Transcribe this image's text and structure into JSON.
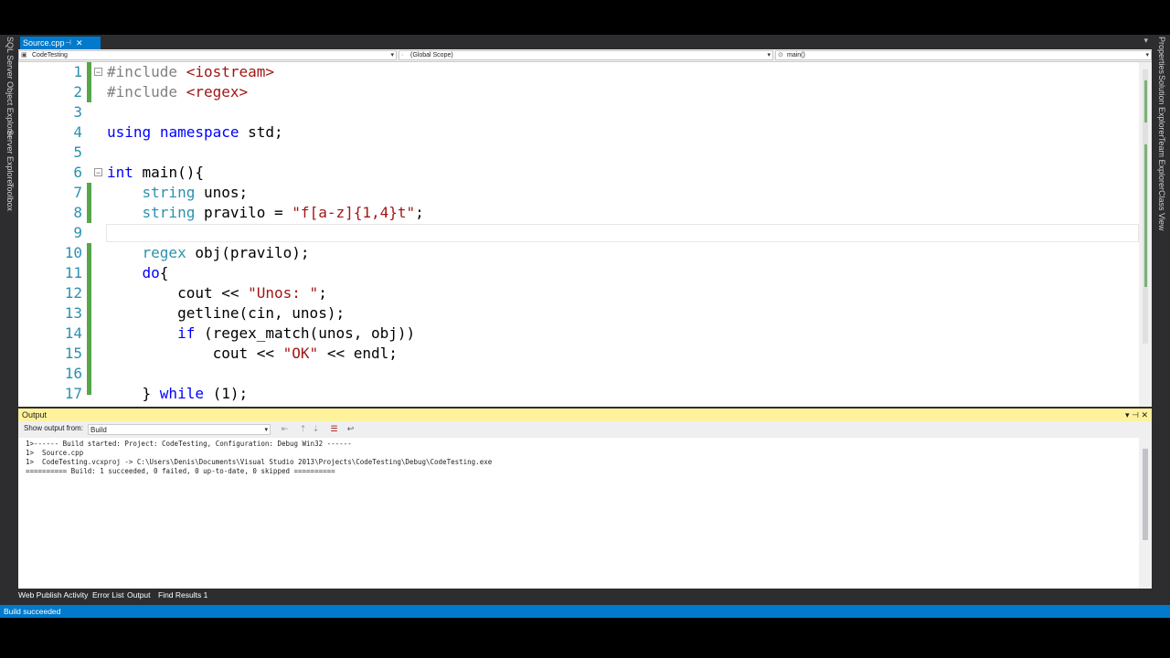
{
  "colors": {
    "accent": "#007acc",
    "line_numbers": "#2b91af",
    "keyword": "#0000ff",
    "preprocessor": "#808080",
    "string": "#a31515",
    "change_marker": "#57a64a",
    "output_title_bg": "#fff29d"
  },
  "left_rail": {
    "items": [
      "SQL Server Object Explorer",
      "Server Explorer",
      "Toolbox"
    ]
  },
  "right_rail": {
    "items": [
      "Properties",
      "Solution Explorer",
      "Team Explorer",
      "Class View"
    ]
  },
  "document_tab": {
    "name": "Source.cpp",
    "pin_icon": "pin-icon",
    "close_icon": "close-icon"
  },
  "navbar": {
    "project": "CodeTesting",
    "scope": "(Global Scope)",
    "member": "main()"
  },
  "editor": {
    "lines": [
      {
        "n": "1",
        "text": "#include <iostream>"
      },
      {
        "n": "2",
        "text": "#include <regex>"
      },
      {
        "n": "3",
        "text": ""
      },
      {
        "n": "4",
        "text": "using namespace std;"
      },
      {
        "n": "5",
        "text": ""
      },
      {
        "n": "6",
        "text": "int main(){"
      },
      {
        "n": "7",
        "text": "    string unos;"
      },
      {
        "n": "8",
        "text": "    string pravilo = \"f[a-z]{1,4}t\";"
      },
      {
        "n": "9",
        "text": ""
      },
      {
        "n": "10",
        "text": "    regex obj(pravilo);"
      },
      {
        "n": "11",
        "text": "    do{"
      },
      {
        "n": "12",
        "text": "        cout << \"Unos: \";"
      },
      {
        "n": "13",
        "text": "        getline(cin, unos);"
      },
      {
        "n": "14",
        "text": "        if (regex_match(unos, obj))"
      },
      {
        "n": "15",
        "text": "            cout << \"OK\" << endl;"
      },
      {
        "n": "16",
        "text": ""
      },
      {
        "n": "17",
        "text": "    } while (1);"
      }
    ]
  },
  "output": {
    "title": "Output",
    "show_from_label": "Show output from:",
    "source": "Build",
    "lines": [
      "1>------ Build started: Project: CodeTesting, Configuration: Debug Win32 ------",
      "1>  Source.cpp",
      "1>  CodeTesting.vcxproj -> C:\\Users\\Denis\\Documents\\Visual Studio 2013\\Projects\\CodeTesting\\Debug\\CodeTesting.exe",
      "========== Build: 1 succeeded, 0 failed, 0 up-to-date, 0 skipped =========="
    ]
  },
  "bottom_tabs": [
    "Web Publish Activity",
    "Error List",
    "Output",
    "Find Results 1"
  ],
  "status": {
    "text": "Build succeeded"
  }
}
